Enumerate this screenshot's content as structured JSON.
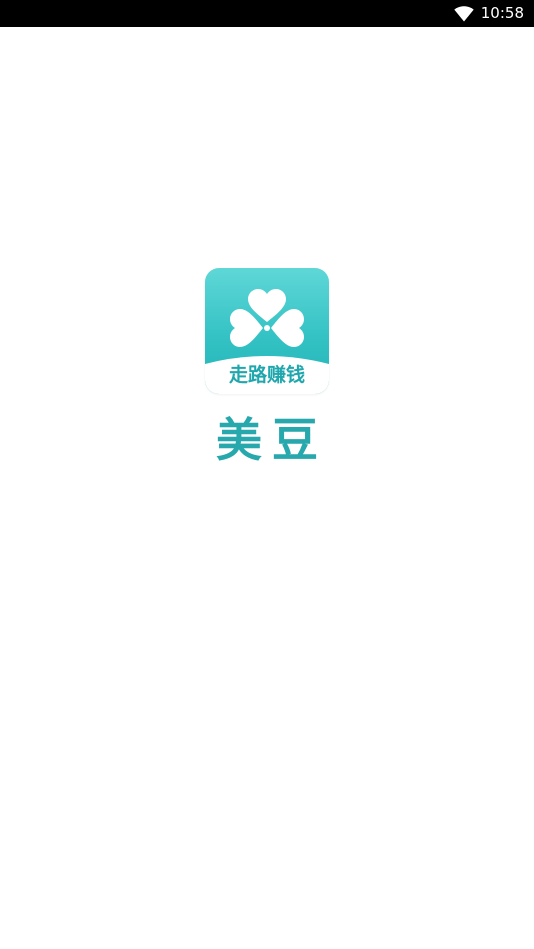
{
  "status_bar": {
    "time": "10:58",
    "wifi_icon": "wifi-icon"
  },
  "splash": {
    "logo": {
      "icon": "clover-hearts-icon",
      "slogan": "走路赚钱",
      "gradient_top": "#5fd7d7",
      "gradient_bottom": "#20b3b6"
    },
    "app_name": "美豆",
    "brand_color": "#26a8ad"
  }
}
